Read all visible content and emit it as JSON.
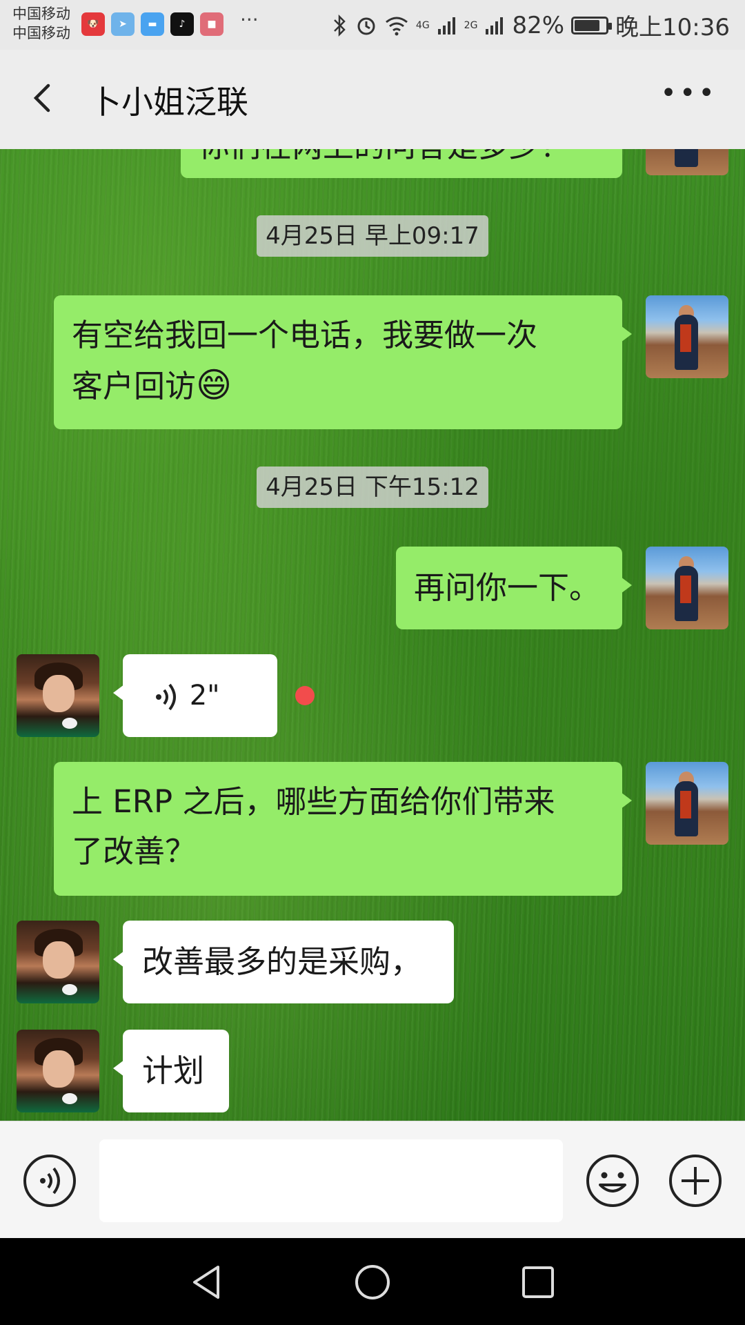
{
  "status_bar": {
    "carrier_1": "中国移动",
    "carrier_2": "中国移动",
    "app_icons": [
      "jd-icon",
      "send-icon",
      "chat-icon",
      "tiktok-icon",
      "app-icon"
    ],
    "more_notifications": "···",
    "network_1": "4G",
    "network_2": "2G",
    "battery": "82%",
    "battery_level": 0.82,
    "time": "晚上10:36"
  },
  "header": {
    "title": "卜小姐泛联",
    "back_icon": "chevron-left-icon",
    "more_icon": "more-dots-icon"
  },
  "messages": [
    {
      "type": "text",
      "from": "me",
      "text": "你们在两上的问答是多少？"
    },
    {
      "type": "time",
      "text": "4月25日 早上09:17"
    },
    {
      "type": "text",
      "from": "me",
      "line1": "有空给我回一个电话，我要做一次",
      "line2": "客户回访",
      "emoji": "😄"
    },
    {
      "type": "time",
      "text": "4月25日 下午15:12"
    },
    {
      "type": "text",
      "from": "me",
      "text": "再问你一下。"
    },
    {
      "type": "voice",
      "from": "them",
      "duration": "2\"",
      "unread": true
    },
    {
      "type": "text",
      "from": "me",
      "line1": "上 ERP 之后，哪些方面给你们带来",
      "line2": "了改善？"
    },
    {
      "type": "text",
      "from": "them",
      "text": "改善最多的是采购，"
    },
    {
      "type": "text",
      "from": "them",
      "text": "计划"
    }
  ],
  "input_bar": {
    "voice_icon": "voice-input-icon",
    "emoji_icon": "emoji-icon",
    "plus_icon": "plus-icon"
  },
  "nav_bar": {
    "back": "nav-back-icon",
    "home": "nav-home-icon",
    "recents": "nav-recents-icon"
  },
  "colors": {
    "my_bubble": "#95ec69",
    "their_bubble": "#ffffff",
    "unread_dot": "#f24c4c"
  }
}
